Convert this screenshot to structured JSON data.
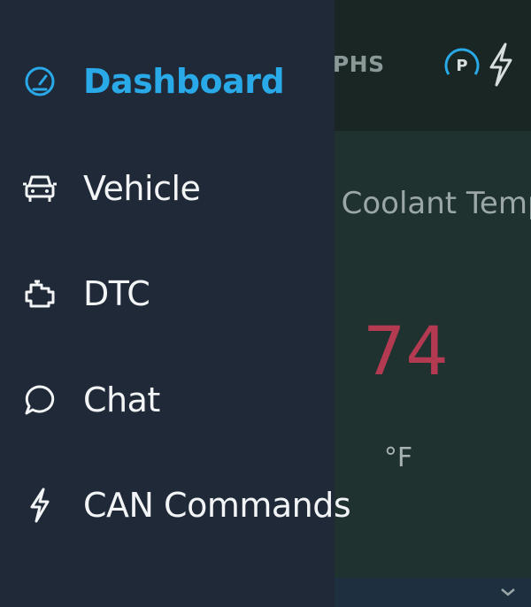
{
  "background": {
    "header": {
      "tab_label": "APHS",
      "park_letter": "P"
    },
    "card": {
      "title": ". Coolant Temp",
      "value": "74",
      "unit": "°F"
    }
  },
  "drawer": {
    "items": [
      {
        "label": "Dashboard",
        "icon": "speedometer-icon",
        "active": true
      },
      {
        "label": "Vehicle",
        "icon": "car-front-icon",
        "active": false
      },
      {
        "label": "DTC",
        "icon": "engine-icon",
        "active": false
      },
      {
        "label": "Chat",
        "icon": "chat-bubble-icon",
        "active": false
      },
      {
        "label": "CAN Commands",
        "icon": "lightning-bolt-icon",
        "active": false
      }
    ]
  },
  "colors": {
    "drawer_bg": "#1f2937",
    "active": "#29a9e8",
    "value": "#b43a52"
  }
}
